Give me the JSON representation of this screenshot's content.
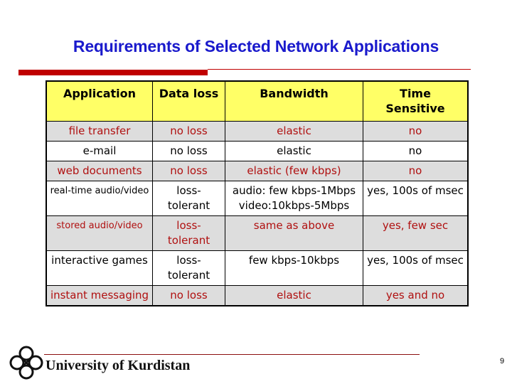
{
  "slide": {
    "title": "Requirements of Selected Network Applications",
    "page_number": "9",
    "footer_org": "University of Kurdistan"
  },
  "table": {
    "headers": [
      "Application",
      "Data loss",
      "Bandwidth",
      "Time Sensitive"
    ],
    "header_lines": {
      "time_sensitive": [
        "Time",
        "Sensitive"
      ]
    },
    "rows": [
      {
        "style": "alt",
        "cells": [
          "file transfer",
          "no loss",
          "elastic",
          "no"
        ]
      },
      {
        "style": "plain",
        "cells": [
          "e-mail",
          "no loss",
          "elastic",
          "no"
        ]
      },
      {
        "style": "alt",
        "cells": [
          "web documents",
          "no loss",
          "elastic (few kbps)",
          "no"
        ]
      },
      {
        "style": "plain",
        "cells": [
          "real-time audio/video",
          "loss-tolerant",
          "audio: few kbps-1Mbps video:10kbps-5Mbps",
          "yes, 100s of msec"
        ]
      },
      {
        "style": "alt",
        "cells": [
          "stored audio/video",
          "loss-tolerant",
          "same as above",
          "yes, few sec"
        ]
      },
      {
        "style": "plain",
        "cells": [
          "interactive games",
          "loss-tolerant",
          "few kbps-10kbps",
          "yes, 100s of msec"
        ]
      },
      {
        "style": "alt",
        "cells": [
          "instant messaging",
          "no loss",
          "elastic",
          "yes and no"
        ]
      }
    ]
  },
  "colors": {
    "title": "#1a1acc",
    "accent_rule": "#c00000",
    "header_bg": "#ffff66",
    "alt_row_bg": "#dddddd",
    "alt_row_text": "#b01010"
  },
  "icons": {
    "logo": "university-logo-icon"
  }
}
